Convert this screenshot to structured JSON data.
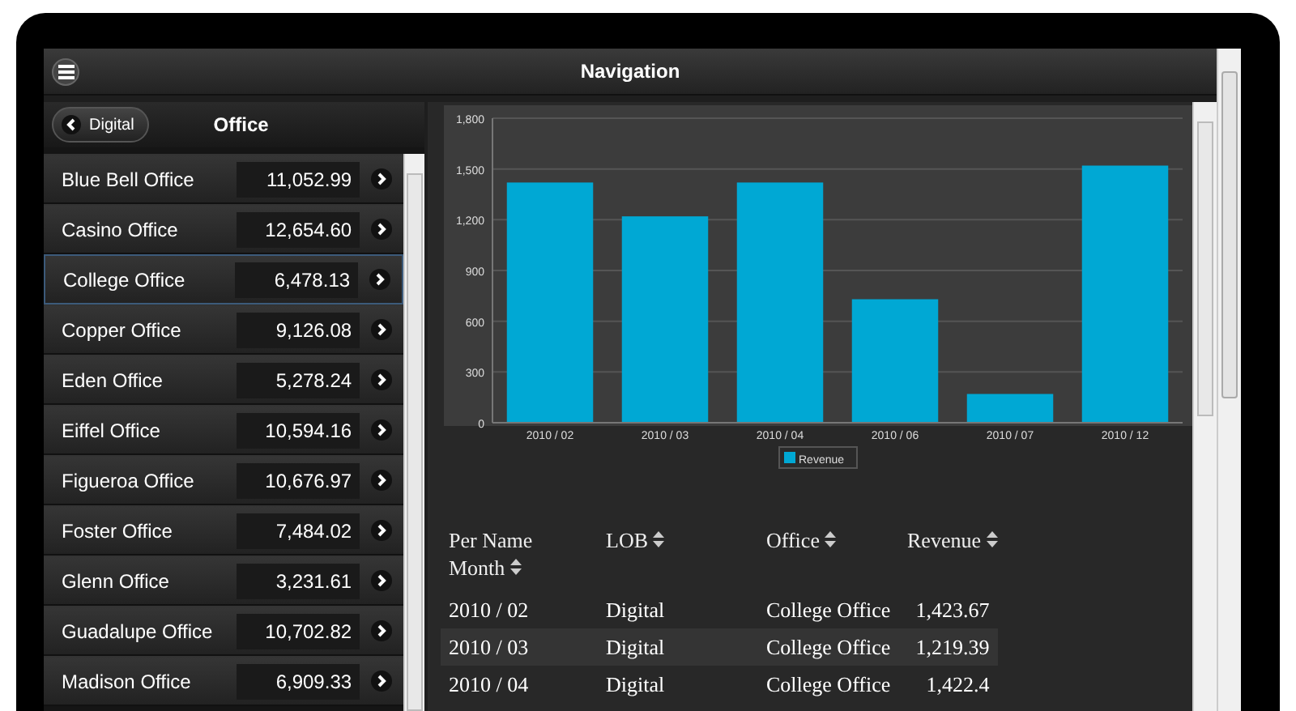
{
  "header": {
    "title": "Navigation"
  },
  "sidebar": {
    "back_button": "Digital",
    "title": "Office",
    "items": [
      {
        "name": "Blue Bell Office",
        "value": "11,052.99",
        "selected": false
      },
      {
        "name": "Casino Office",
        "value": "12,654.60",
        "selected": false
      },
      {
        "name": "College Office",
        "value": "6,478.13",
        "selected": true
      },
      {
        "name": "Copper Office",
        "value": "9,126.08",
        "selected": false
      },
      {
        "name": "Eden Office",
        "value": "5,278.24",
        "selected": false
      },
      {
        "name": "Eiffel Office",
        "value": "10,594.16",
        "selected": false
      },
      {
        "name": "Figueroa Office",
        "value": "10,676.97",
        "selected": false
      },
      {
        "name": "Foster Office",
        "value": "7,484.02",
        "selected": false
      },
      {
        "name": "Glenn Office",
        "value": "3,231.61",
        "selected": false
      },
      {
        "name": "Guadalupe Office",
        "value": "10,702.82",
        "selected": false
      },
      {
        "name": "Madison Office",
        "value": "6,909.33",
        "selected": false
      }
    ]
  },
  "chart": {
    "chart_data": {
      "type": "bar",
      "categories": [
        "2010 / 02",
        "2010 / 03",
        "2010 / 04",
        "2010 / 06",
        "2010 / 07",
        "2010 / 12"
      ],
      "series": [
        {
          "name": "Revenue",
          "color": "#00a8d4",
          "values": [
            1420,
            1220,
            1420,
            730,
            170,
            1520
          ]
        }
      ],
      "grid": true,
      "ylim": [
        0,
        1800
      ],
      "yticks": [
        {
          "value": 0,
          "label": "0"
        },
        {
          "value": 300,
          "label": "300"
        },
        {
          "value": 600,
          "label": "600"
        },
        {
          "value": 900,
          "label": "900"
        },
        {
          "value": 1200,
          "label": "1,200"
        },
        {
          "value": 1500,
          "label": "1,500"
        },
        {
          "value": 1800,
          "label": "1,800"
        }
      ]
    }
  },
  "table": {
    "columns": [
      "Per Name Month",
      "LOB",
      "Office",
      "Revenue"
    ],
    "rows": [
      [
        "2010 / 02",
        "Digital",
        "College Office",
        "1,423.67"
      ],
      [
        "2010 / 03",
        "Digital",
        "College Office",
        "1,219.39"
      ],
      [
        "2010 / 04",
        "Digital",
        "College Office",
        "1,422.4"
      ]
    ]
  }
}
